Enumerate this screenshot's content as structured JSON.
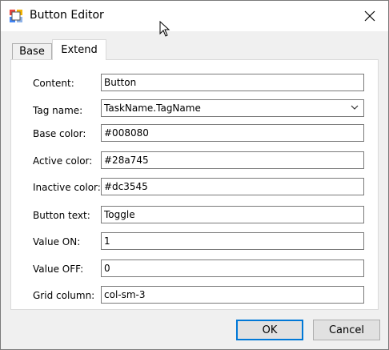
{
  "window": {
    "title": "Button Editor"
  },
  "tabs": [
    {
      "label": "Base"
    },
    {
      "label": "Extend"
    }
  ],
  "form": {
    "content": {
      "label": "Content:",
      "value": "Button"
    },
    "tag_name": {
      "label": "Tag name:",
      "value": "TaskName.TagName"
    },
    "base_color": {
      "label": "Base color:",
      "value": "#008080"
    },
    "active_color": {
      "label": "Active color:",
      "value": "#28a745"
    },
    "inactive_color": {
      "label": "Inactive color:",
      "value": "#dc3545"
    },
    "button_text": {
      "label": "Button text:",
      "value": "Toggle"
    },
    "value_on": {
      "label": "Value ON:",
      "value": "1"
    },
    "value_off": {
      "label": "Value OFF:",
      "value": "0"
    },
    "grid_column": {
      "label": "Grid column:",
      "value": "col-sm-3"
    }
  },
  "buttons": {
    "ok": "OK",
    "cancel": "Cancel"
  },
  "colors": {
    "accent": "#0078d7",
    "panel": "#ffffff",
    "window": "#f0f0f0"
  },
  "icons": {
    "app": "app-icon",
    "close": "close-icon",
    "dropdown": "chevron-down-icon",
    "cursor": "cursor-icon"
  }
}
